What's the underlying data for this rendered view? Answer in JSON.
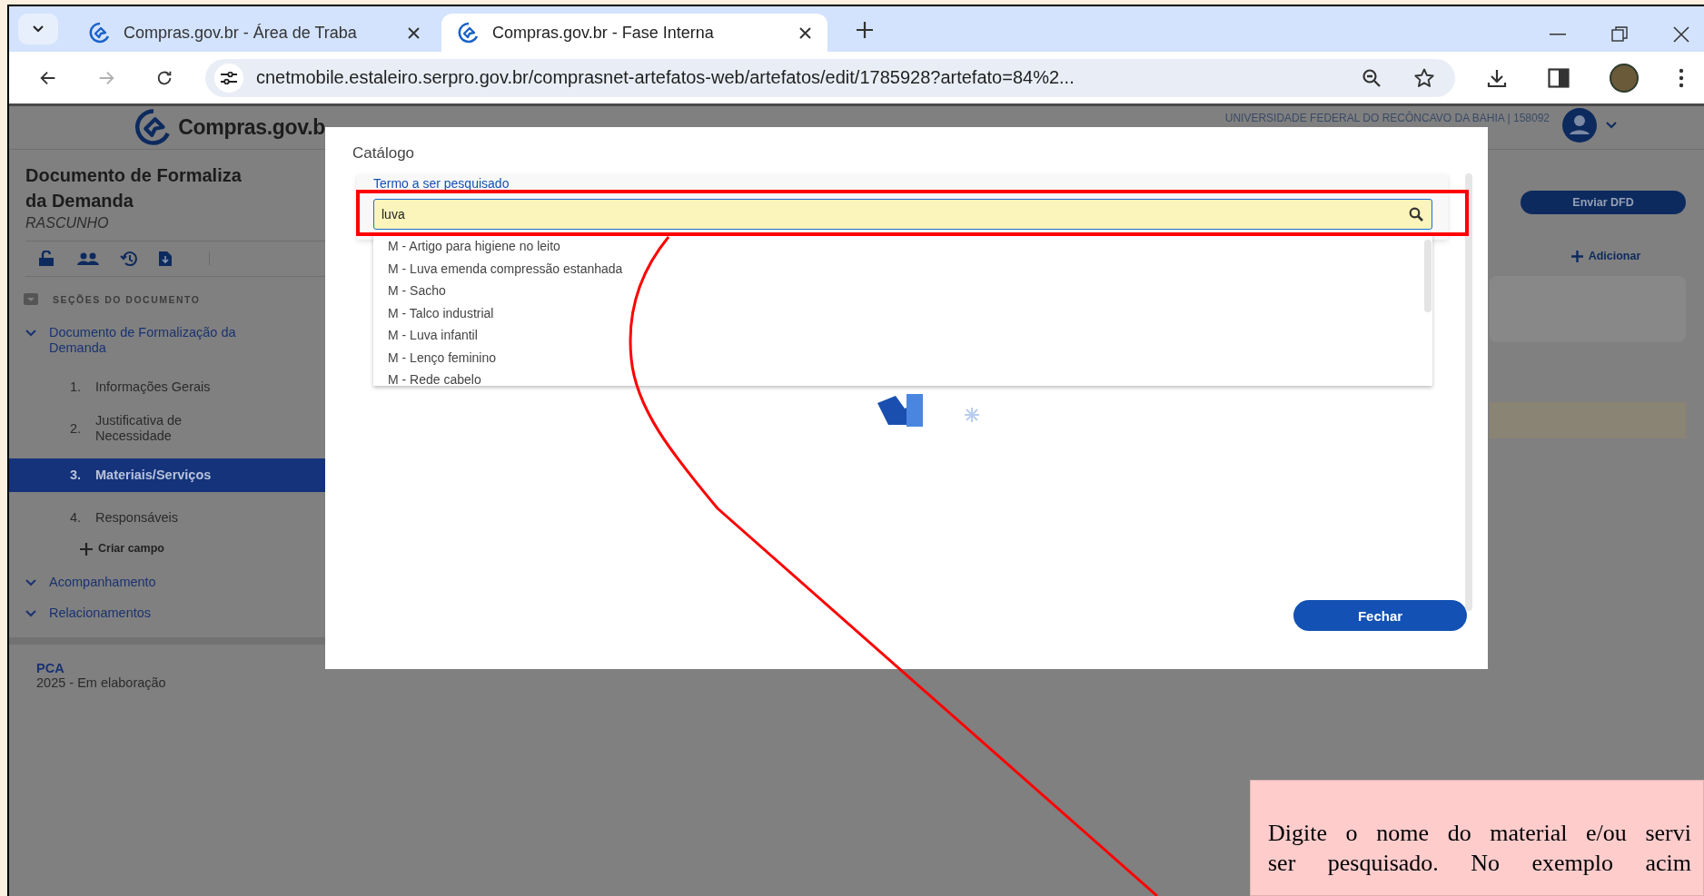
{
  "browser": {
    "tabs": [
      {
        "title": "Compras.gov.br - Área de Traba",
        "selected": false
      },
      {
        "title": "Compras.gov.br - Fase Interna",
        "selected": true
      }
    ],
    "forward_disabled": true,
    "url": "cnetmobile.estaleiro.serpro.gov.br/comprasnet-artefatos-web/artefatos/edit/1785928?artefato=84%2..."
  },
  "header": {
    "logo": "Compras.gov.b",
    "organization": "UNIVERSIDADE FEDERAL DO RECÔNCAVO DA BAHIA | 158092"
  },
  "sidebar": {
    "title_lines": [
      "Documento de Formaliza",
      "da Demanda"
    ],
    "status": "RASCUNHO",
    "sections_label": "SEÇÕES DO DOCUMENTO",
    "tree": [
      {
        "label": "Documento de Formalização da Demanda",
        "children": [
          {
            "kind": "section",
            "number": "1.",
            "label": "Informações Gerais",
            "selected": false
          },
          {
            "kind": "section",
            "number": "2.",
            "label": "Justificativa de Necessidade",
            "selected": false
          },
          {
            "kind": "section",
            "number": "3.",
            "label": "Materiais/Serviços",
            "selected": true
          },
          {
            "kind": "section",
            "number": "4.",
            "label": "Responsáveis",
            "selected": false
          },
          {
            "kind": "add",
            "label": "Criar campo"
          }
        ]
      },
      {
        "label": "Acompanhamento"
      },
      {
        "label": "Relacionamentos"
      }
    ],
    "pca": {
      "label": "PCA",
      "status": "2025 - Em elaboração"
    }
  },
  "main": {
    "send_button": "Enviar DFD",
    "add_button": "Adicionar"
  },
  "modal": {
    "title": "Catálogo",
    "search": {
      "label": "Termo a ser pesquisado",
      "value": "luva"
    },
    "results": [
      "M - Artigo para higiene no leito",
      "M - Luva emenda compressão estanhada",
      "M - Sacho",
      "M - Talco industrial",
      "M - Luva infantil",
      "M - Lenço feminino",
      "M - Rede cabelo"
    ],
    "close_button": "Fechar"
  },
  "callout": {
    "lines": [
      "Digite o nome do material e/ou servi",
      "ser pesquisado. No exemplo acim"
    ]
  }
}
